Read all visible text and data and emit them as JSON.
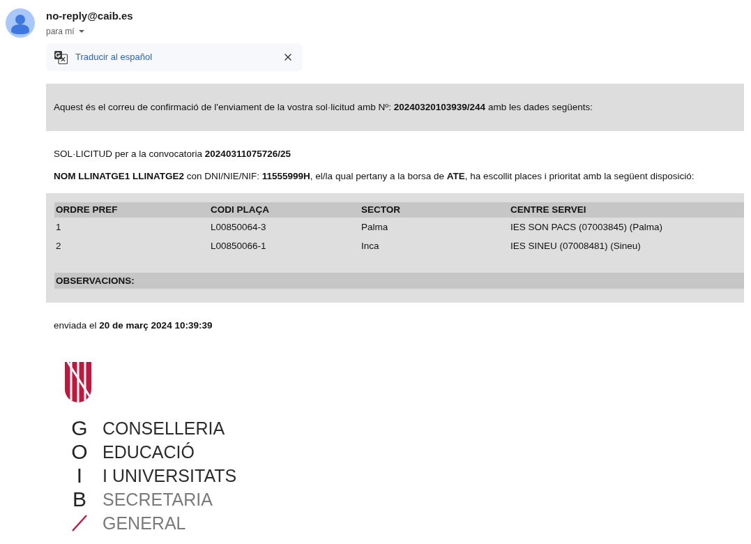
{
  "message_header": {
    "sender": "no-reply@caib.es",
    "recipient": "para mí"
  },
  "translate_bar": {
    "link": "Traducir al español"
  },
  "email_body": {
    "intro": "Aquest és el correu de confirmació de l'enviament de la vostra sol·licitud amb Nº: **20240320103939/244** amb les dades següents:",
    "application_line": "SOL·LICITUD per a la convocatoria **20240311075726/25**",
    "statement": "**NOM LLINATGE1 LLINATGE2** con DNI/NIE/NIF: **11555999H**, el/la qual pertany a la borsa de **ATE**, ha escollit places i prioritat amb la següent disposició:",
    "table": {
      "columns": [
        "ORDRE PREF",
        "CODI PLAÇA",
        "SECTOR",
        "CENTRE SERVEI"
      ],
      "rows": [
        [
          "1",
          "L00850064-3",
          "Palma",
          "IES SON PACS (07003845) (Palma)"
        ],
        [
          "2",
          "L00850066-1",
          "Inca",
          "IES SINEU (07008481) (Sineu)"
        ]
      ]
    },
    "observations_label": "OBSERVACIONS:",
    "sent_line": "enviada el **20 de març 2024 10:39:39**"
  },
  "logo": {
    "letters": [
      "G",
      "O",
      "I",
      "B"
    ],
    "lines": [
      {
        "text": "CONSELLERIA",
        "kind": "primary"
      },
      {
        "text": "EDUCACIÓ",
        "kind": "primary"
      },
      {
        "text": "I UNIVERSITATS",
        "kind": "primary"
      },
      {
        "text": "SECRETARIA",
        "kind": "secondary"
      },
      {
        "text": "GENERAL",
        "kind": "secondary"
      }
    ]
  }
}
